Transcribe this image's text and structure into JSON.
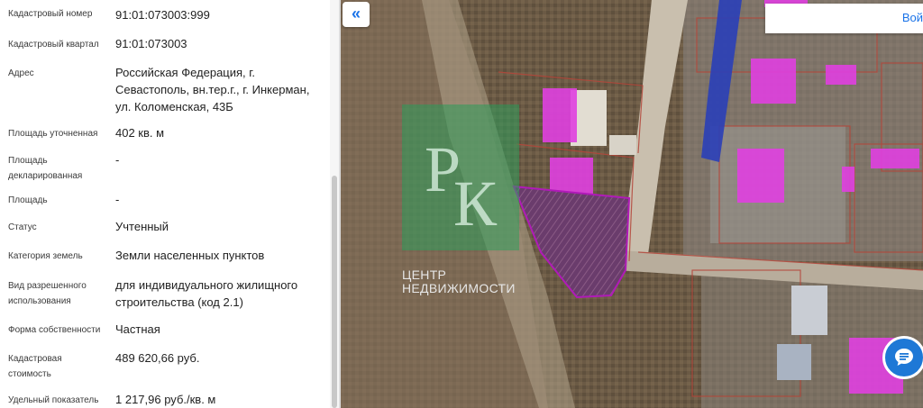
{
  "panel": {
    "rows": [
      {
        "label": "Кадастровый номер",
        "value": "91:01:073003:999"
      },
      {
        "label": "Кадастровый квартал",
        "value": "91:01:073003"
      },
      {
        "label": "Адрес",
        "value": "Российская Федерация, г. Севастополь, вн.тер.г., г. Инкерман, ул. Коломенская, 43Б"
      },
      {
        "label": "Площадь уточненная",
        "value": "402 кв. м"
      },
      {
        "label": "Площадь декларированная",
        "value": "-"
      },
      {
        "label": "Площадь",
        "value": "-"
      },
      {
        "label": "Статус",
        "value": "Учтенный"
      },
      {
        "label": "Категория земель",
        "value": "Земли населенных пунктов"
      },
      {
        "label": "Вид разрешенного использования",
        "value": "для индивидуального жилищного строительства (код 2.1)"
      },
      {
        "label": "Форма собственности",
        "value": "Частная"
      },
      {
        "label": "Кадастровая стоимость",
        "value": "489 620,66 руб."
      },
      {
        "label": "Удельный показатель",
        "value": "1 217,96 руб./кв. м"
      }
    ]
  },
  "map": {
    "collapse_icon": "«",
    "search_button_label": "Вой",
    "watermark": {
      "monogram": "РК",
      "line1": "ЦЕНТР",
      "line2": "НЕДВИЖИМОСТИ"
    },
    "chat_icon": "chat-icon"
  },
  "colors": {
    "accent": "#1a73e8",
    "parcel_outline": "#b01ab8",
    "building_fill": "#e040e0",
    "watermark_green": "#2e9e5b"
  }
}
